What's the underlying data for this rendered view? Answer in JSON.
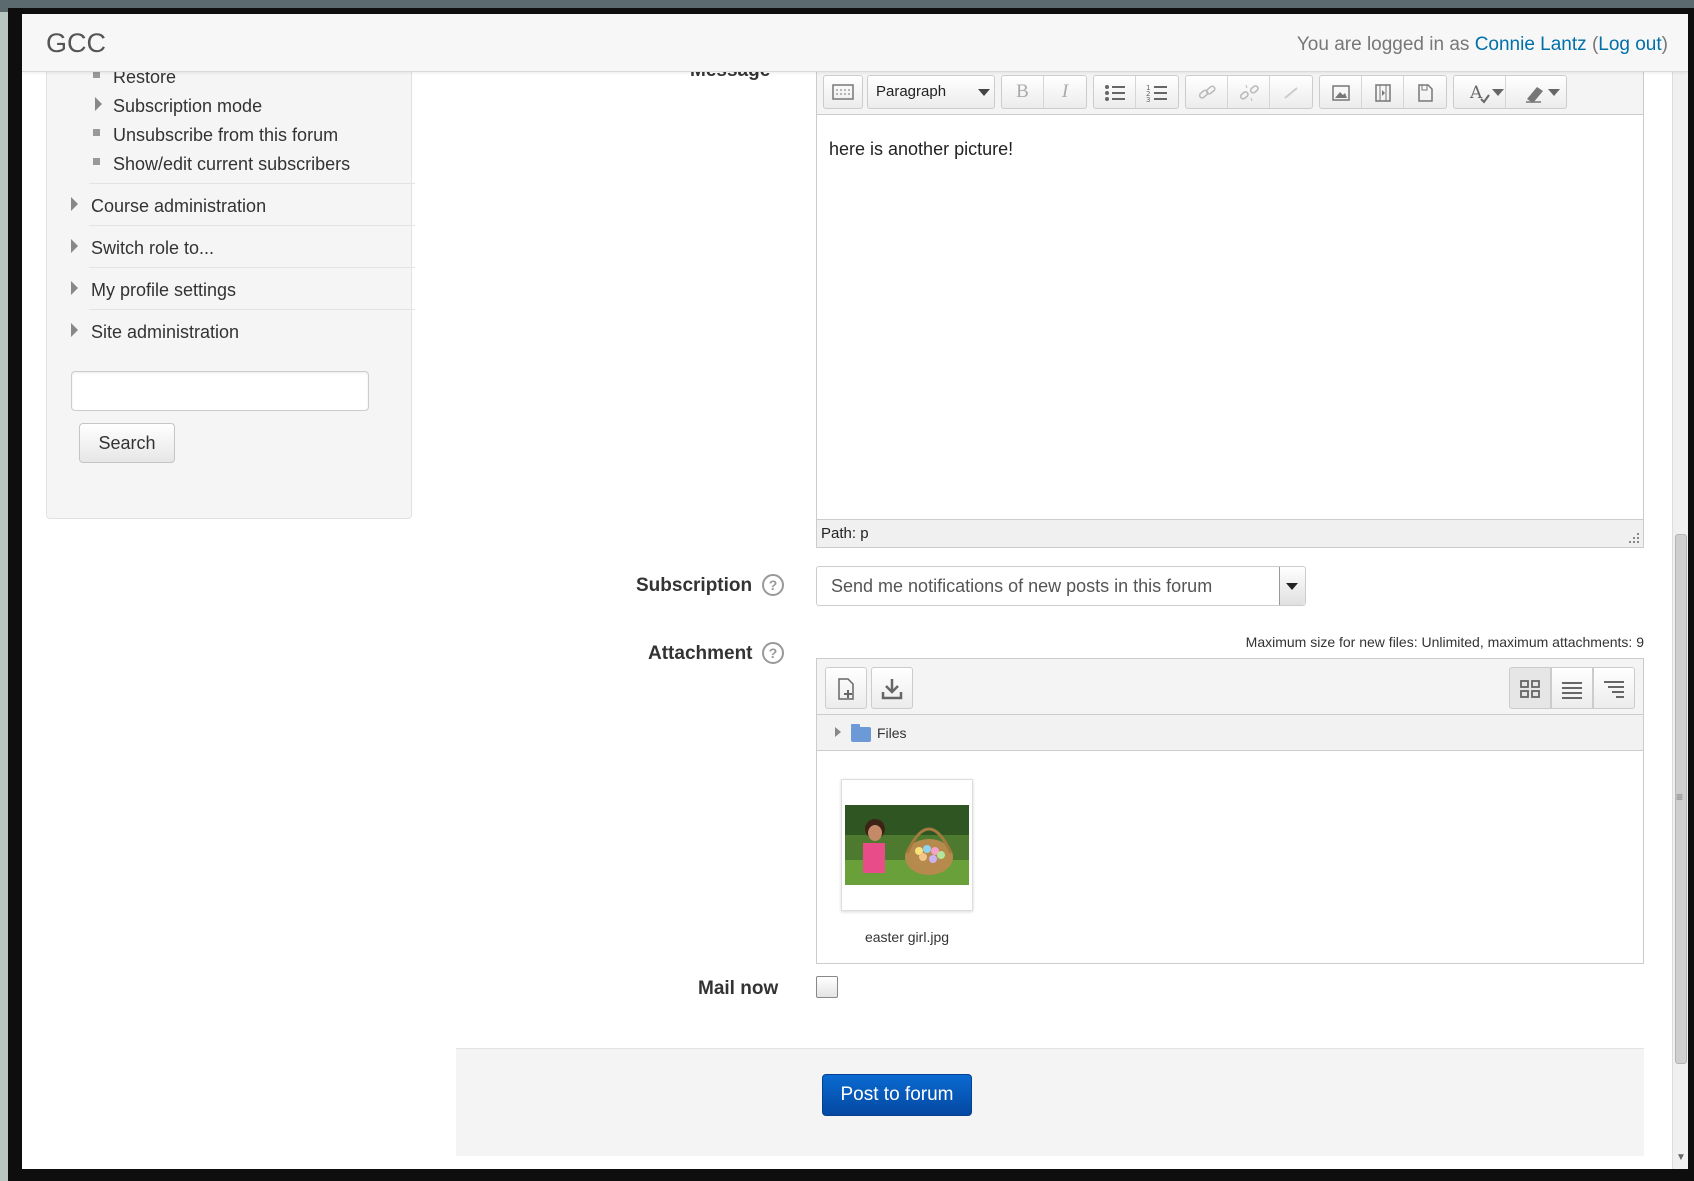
{
  "navbar": {
    "brand": "GCC",
    "login_prefix": "You are logged in as ",
    "user_name": "Connie Lantz",
    "logout_open": "(",
    "logout_label": "Log out",
    "logout_close": ")"
  },
  "sidebar": {
    "sub_items": [
      {
        "label": "Restore"
      },
      {
        "label": "Subscription mode"
      },
      {
        "label": "Unsubscribe from this forum"
      },
      {
        "label": "Show/edit current subscribers"
      }
    ],
    "sections": [
      {
        "label": "Course administration"
      },
      {
        "label": "Switch role to..."
      },
      {
        "label": "My profile settings"
      },
      {
        "label": "Site administration"
      }
    ],
    "search_value": "",
    "search_button": "Search"
  },
  "form": {
    "message_label": "Message",
    "editor": {
      "format": "Paragraph",
      "bold": "B",
      "italic": "I",
      "content": "here is another picture!",
      "path": "Path: p"
    },
    "subscription_label": "Subscription",
    "subscription_value": "Send me notifications of new posts in this forum",
    "attachment_label": "Attachment",
    "max_size_text": "Maximum size for new files: Unlimited, maximum attachments: 9",
    "folder_label": "Files",
    "file_name": "easter girl.jpg",
    "mailnow_label": "Mail now",
    "mailnow_checked": false,
    "submit_label": "Post to forum"
  },
  "colors": {
    "link": "#0070a8",
    "primary_button": "#0a5bc0"
  }
}
